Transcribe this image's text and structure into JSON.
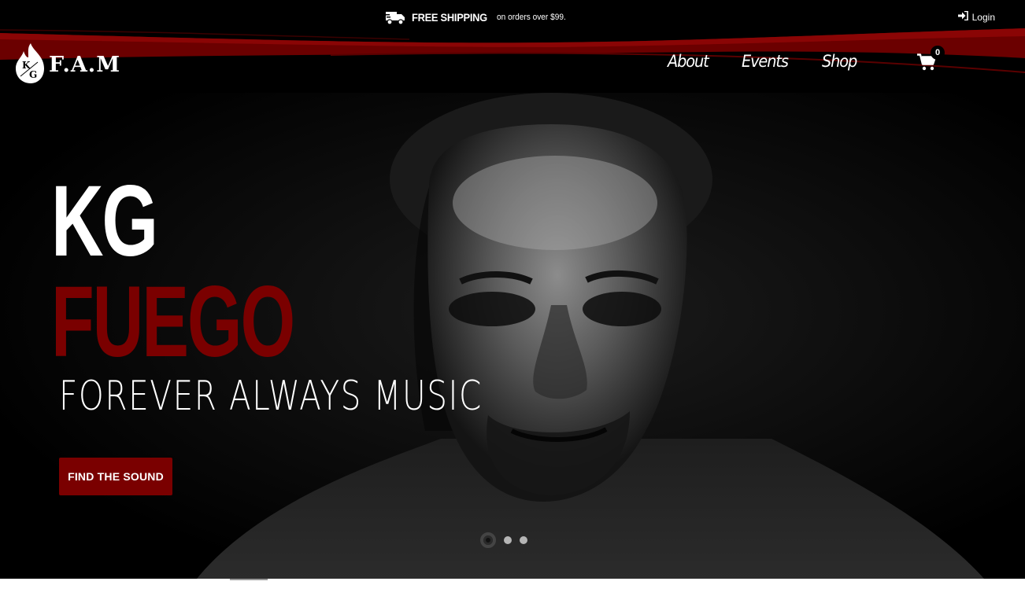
{
  "topbar": {
    "shipping_strong": "FREE SHIPPING",
    "shipping_small": "on orders over $99.",
    "login_label": "Login",
    "truck_icon": "truck-icon",
    "login_icon": "sign-in-icon"
  },
  "header": {
    "logo_text": "F.A.M",
    "logo_letters": "KG",
    "nav": [
      {
        "label": "About"
      },
      {
        "label": "Events"
      },
      {
        "label": "Shop"
      }
    ],
    "cart_count": "0",
    "cart_icon": "shopping-cart-icon"
  },
  "hero": {
    "title_line1": "KG",
    "title_line2": "FUEGO",
    "subtitle": "FOREVER ALWAYS MUSIC",
    "cta_label": "FIND THE SOUND",
    "slides_total": 3,
    "active_slide": 1
  },
  "colors": {
    "brand_red": "#7a0000",
    "background": "#000000",
    "text": "#ffffff"
  }
}
